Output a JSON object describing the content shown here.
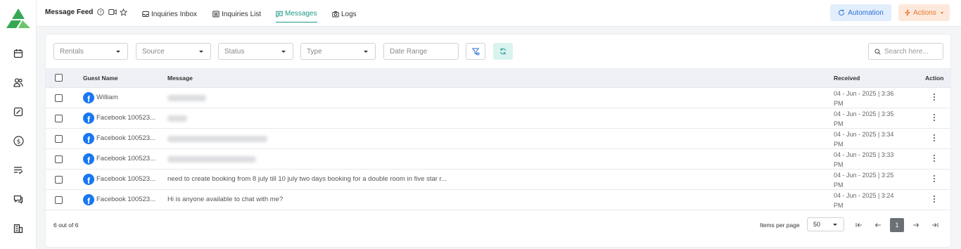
{
  "app": {
    "brand_color": "#35a852",
    "accent": "#1b9a8b"
  },
  "sidebar": {
    "icons": [
      "calendar-icon",
      "users-icon",
      "edit-icon",
      "dollar-icon",
      "checklist-icon",
      "chat-icon",
      "building-icon"
    ]
  },
  "header": {
    "title": "Message Feed",
    "tabs": [
      {
        "label": "Inquiries Inbox",
        "icon": "inbox-icon"
      },
      {
        "label": "Inquiries List",
        "icon": "list-icon"
      },
      {
        "label": "Messages",
        "icon": "message-icon",
        "active": true
      },
      {
        "label": "Logs",
        "icon": "camera-icon"
      }
    ],
    "automation_label": "Automation",
    "actions_label": "Actions"
  },
  "filters": {
    "rentals": "Rentals",
    "source": "Source",
    "status": "Status",
    "type": "Type",
    "date_range": "Date Range",
    "search_placeholder": "Search here..."
  },
  "table": {
    "headers": {
      "guest": "Guest Name",
      "message": "Message",
      "received": "Received",
      "action": "Action"
    },
    "rows": [
      {
        "guest": "William",
        "message": "",
        "received_line1": "04 - Jun - 2025 | 3:36",
        "received_line2": "PM"
      },
      {
        "guest": "Facebook 100523...",
        "message": "",
        "received_line1": "04 - Jun - 2025 | 3:35",
        "received_line2": "PM"
      },
      {
        "guest": "Facebook 100523...",
        "message": "",
        "received_line1": "04 - Jun - 2025 | 3:34",
        "received_line2": "PM"
      },
      {
        "guest": "Facebook 100523...",
        "message": "",
        "received_line1": "04 - Jun - 2025 | 3:33",
        "received_line2": "PM"
      },
      {
        "guest": "Facebook 100523...",
        "message": "need to create booking from 8 july till 10 july two days booking for a double room in five star r...",
        "received_line1": "04 - Jun - 2025 | 3:25",
        "received_line2": "PM"
      },
      {
        "guest": "Facebook 100523...",
        "message": "Hi is anyone available to chat with me?",
        "received_line1": "04 - Jun - 2025 | 3:24",
        "received_line2": "PM"
      }
    ]
  },
  "footer": {
    "count": "6 out of 6",
    "items_per_page_label": "Items per page",
    "items_per_page": "50",
    "current_page": "1"
  }
}
